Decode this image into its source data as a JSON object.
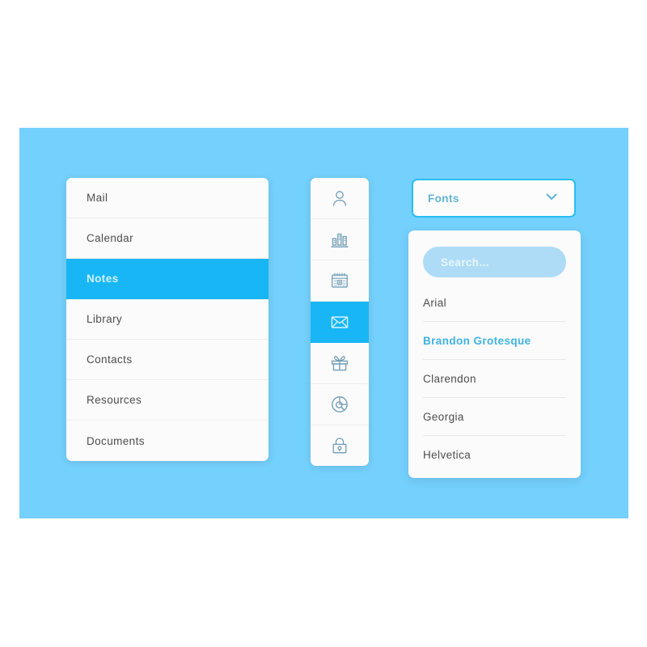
{
  "theme": {
    "canvas_bg": "#74D0FC",
    "accent": "#18B6F4",
    "panel_bg": "#FBFBFB",
    "text": "#4d4d4d",
    "muted_icon": "#6E9CB5",
    "search_bg": "#AEDCF7",
    "selected_font_color": "#3FB3E4"
  },
  "menu": {
    "items": [
      {
        "label": "Mail",
        "selected": false
      },
      {
        "label": "Calendar",
        "selected": false
      },
      {
        "label": "Notes",
        "selected": true
      },
      {
        "label": "Library",
        "selected": false
      },
      {
        "label": "Contacts",
        "selected": false
      },
      {
        "label": "Resources",
        "selected": false
      },
      {
        "label": "Documents",
        "selected": false
      }
    ]
  },
  "icon_bar": {
    "items": [
      {
        "icon": "person-icon",
        "selected": false
      },
      {
        "icon": "bar-chart-icon",
        "selected": false
      },
      {
        "icon": "calendar-icon",
        "selected": false
      },
      {
        "icon": "envelope-icon",
        "selected": true
      },
      {
        "icon": "gift-icon",
        "selected": false
      },
      {
        "icon": "pie-search-icon",
        "selected": false
      },
      {
        "icon": "lock-icon",
        "selected": false
      }
    ]
  },
  "fonts_dropdown": {
    "header_label": "Fonts",
    "chevron_icon": "chevron-down-icon",
    "search": {
      "placeholder": "Search...",
      "value": ""
    },
    "options": [
      {
        "label": "Arial",
        "selected": false
      },
      {
        "label": "Brandon Grotesque",
        "selected": true
      },
      {
        "label": "Clarendon",
        "selected": false
      },
      {
        "label": "Georgia",
        "selected": false
      },
      {
        "label": "Helvetica",
        "selected": false
      }
    ]
  }
}
